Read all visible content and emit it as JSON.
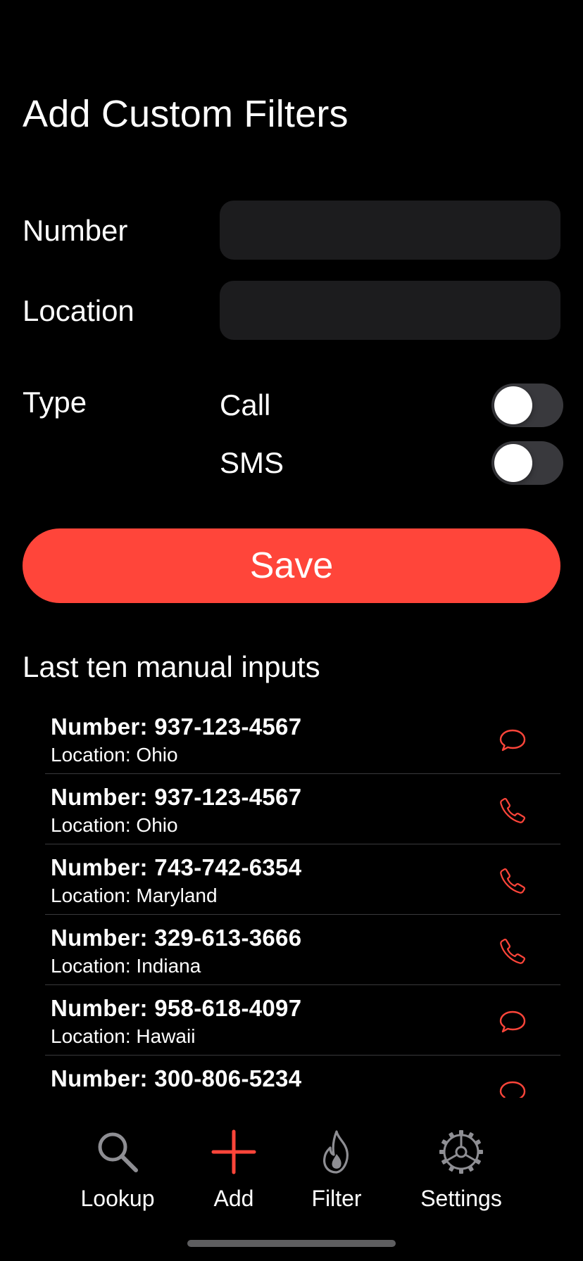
{
  "page_title": "Add Custom Filters",
  "form": {
    "number_label": "Number",
    "number_value": "",
    "location_label": "Location",
    "location_value": "",
    "type_label": "Type",
    "call_label": "Call",
    "call_enabled": false,
    "sms_label": "SMS",
    "sms_enabled": false,
    "save_label": "Save"
  },
  "recent": {
    "title": "Last ten manual inputs",
    "items": [
      {
        "number": "Number: 937-123-4567",
        "location": "Location: Ohio",
        "icon": "message-icon"
      },
      {
        "number": "Number: 937-123-4567",
        "location": "Location: Ohio",
        "icon": "phone-icon"
      },
      {
        "number": "Number: 743-742-6354",
        "location": "Location: Maryland",
        "icon": "phone-icon"
      },
      {
        "number": "Number: 329-613-3666",
        "location": "Location: Indiana",
        "icon": "phone-icon"
      },
      {
        "number": "Number: 958-618-4097",
        "location": "Location: Hawaii",
        "icon": "message-icon"
      },
      {
        "number": "Number: 300-806-5234",
        "location": "",
        "icon": "message-icon"
      }
    ]
  },
  "tabs": [
    {
      "label": "Lookup",
      "icon": "search-icon"
    },
    {
      "label": "Add",
      "icon": "plus-icon",
      "selected": true
    },
    {
      "label": "Filter",
      "icon": "flame-icon"
    },
    {
      "label": "Settings",
      "icon": "gear-icon"
    }
  ],
  "colors": {
    "accent": "#ff453a",
    "background": "#000000",
    "field_background": "#1c1c1e",
    "toggle_off": "#39393d",
    "separator": "#3a3a3c",
    "inactive_icon": "#8e8e93"
  }
}
